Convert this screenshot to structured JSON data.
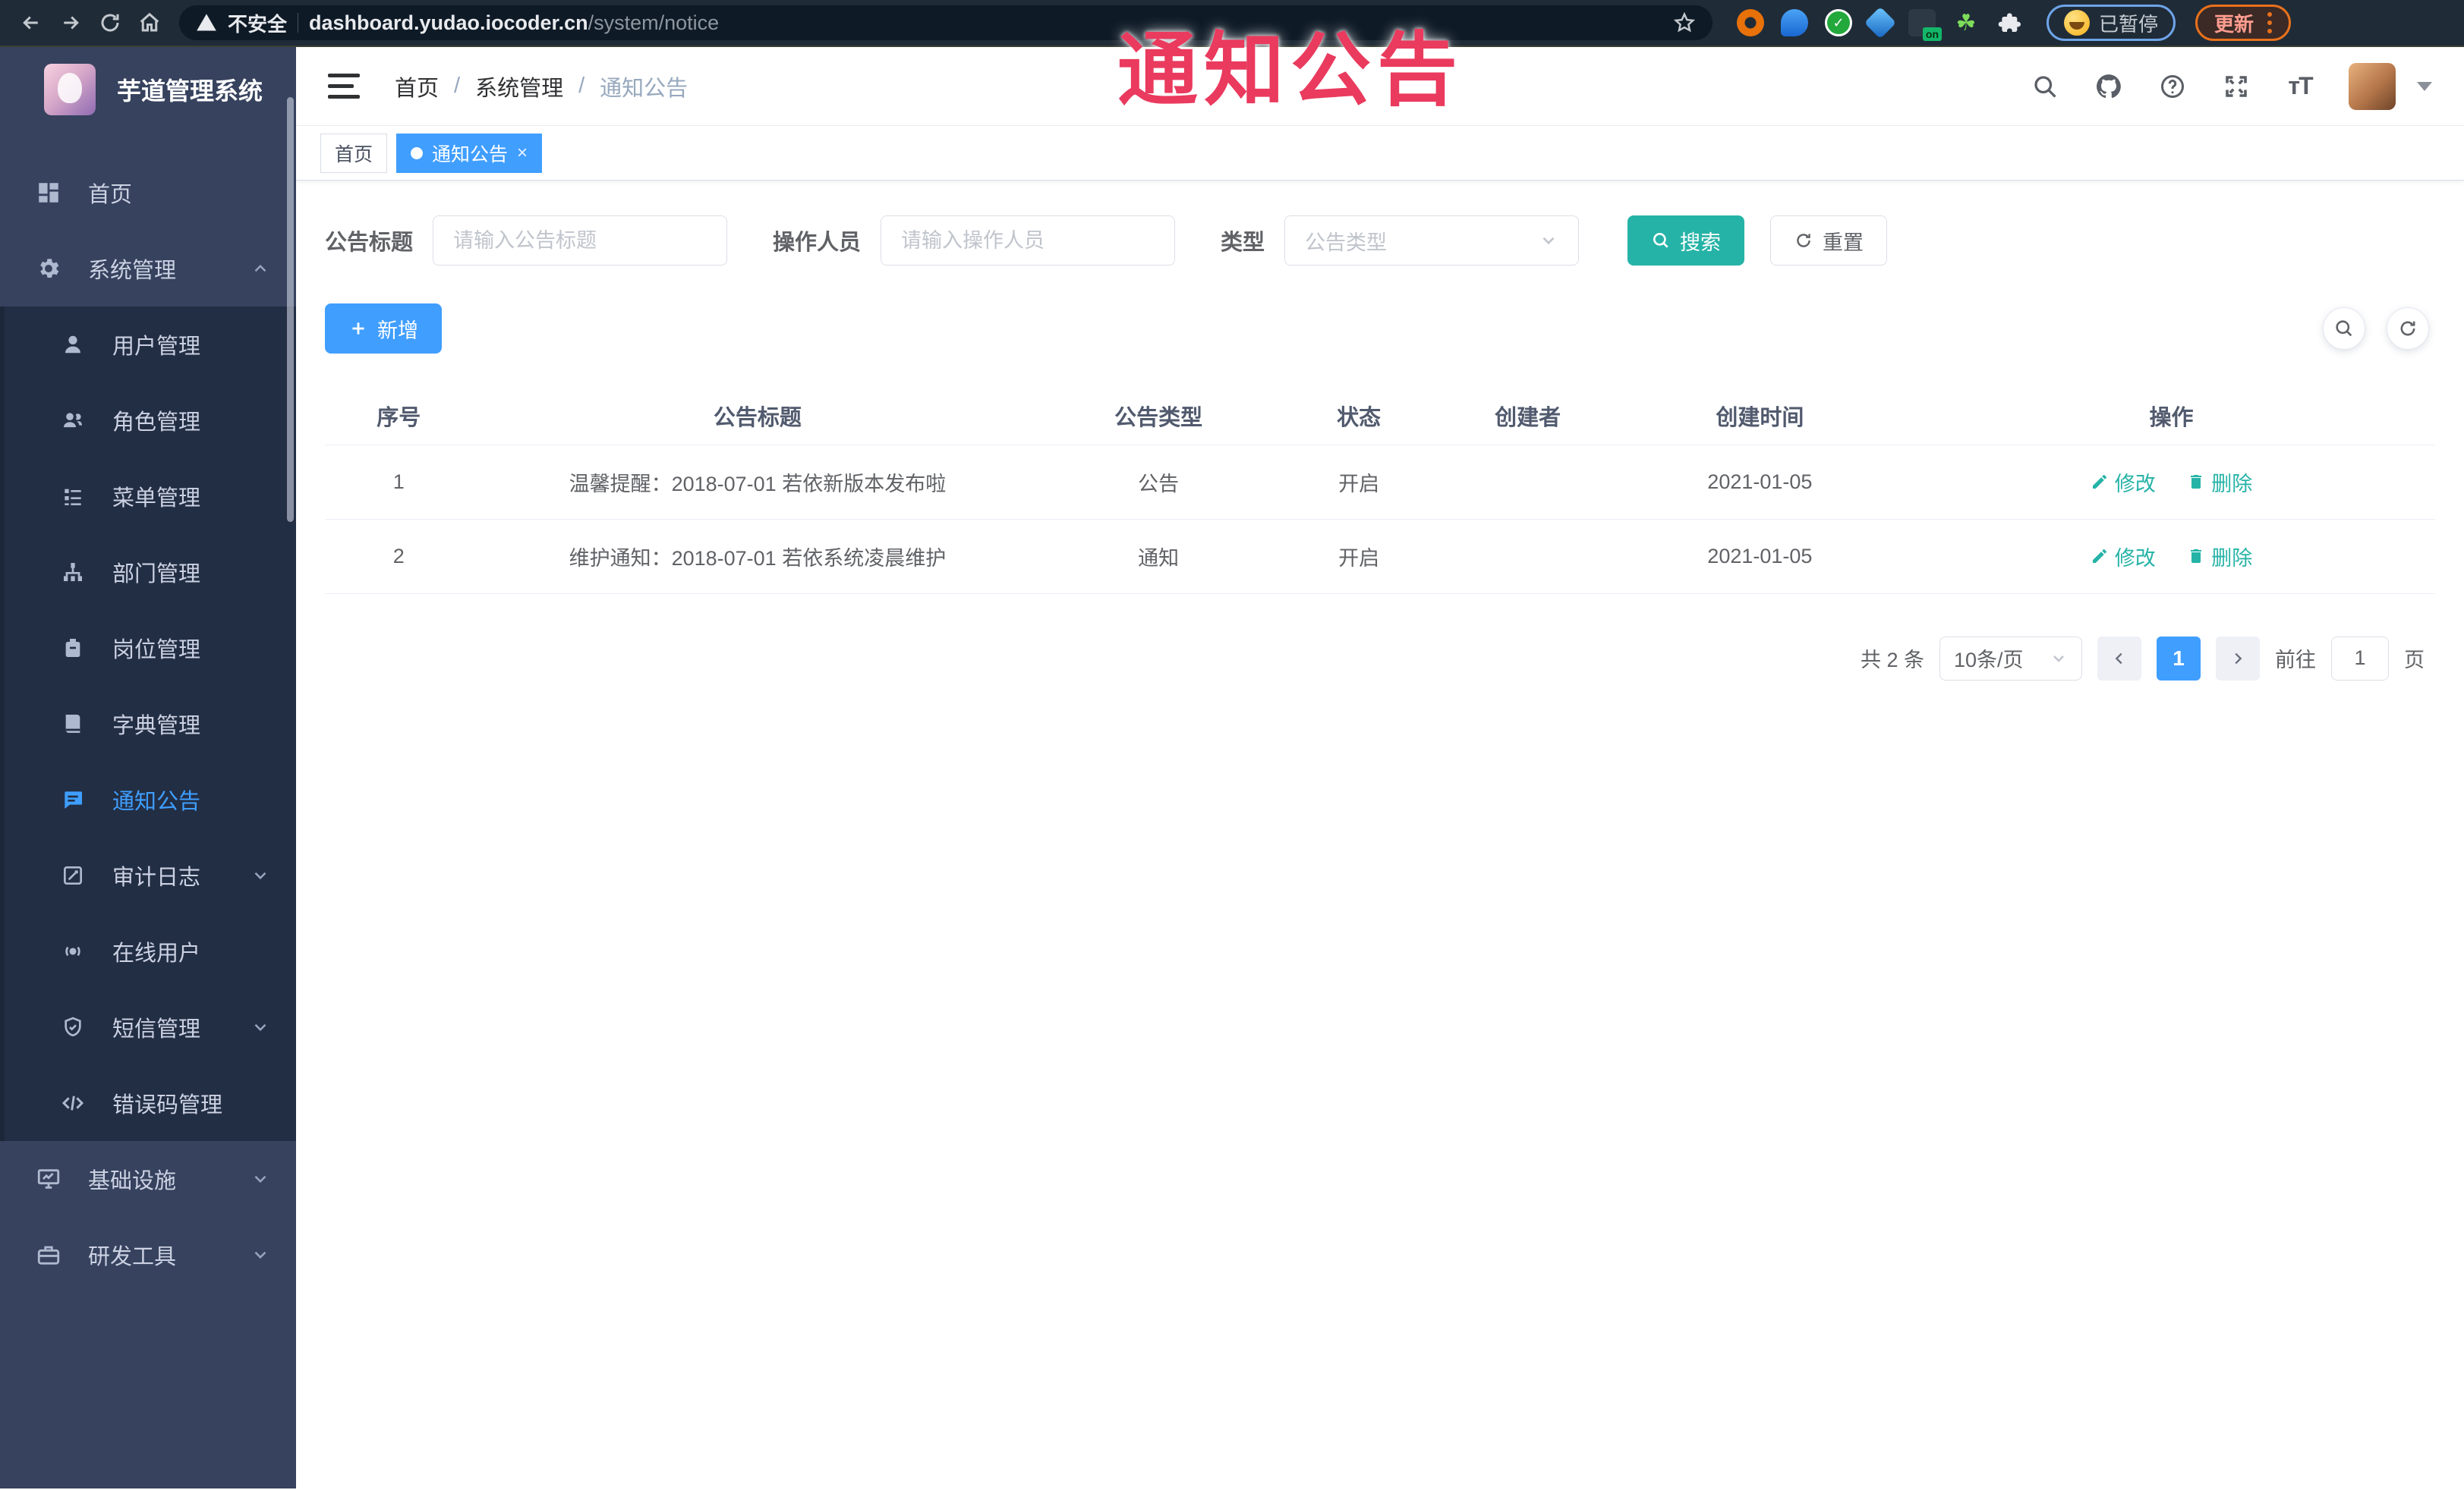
{
  "browser": {
    "security_warning": "不安全",
    "url_host": "dashboard.yudao.iocoder.cn",
    "url_path": "/system/notice",
    "paused_badge": "已暂停",
    "update_button": "更新",
    "extension_badge": "on"
  },
  "overlay": {
    "annotation": "通知公告"
  },
  "sidebar": {
    "app_title": "芋道管理系统",
    "items": [
      {
        "label": "首页",
        "icon": "dashboard-icon"
      },
      {
        "label": "系统管理",
        "icon": "gear-icon"
      },
      {
        "label": "用户管理",
        "icon": "user-icon"
      },
      {
        "label": "角色管理",
        "icon": "users-icon"
      },
      {
        "label": "菜单管理",
        "icon": "menu-list-icon"
      },
      {
        "label": "部门管理",
        "icon": "org-tree-icon"
      },
      {
        "label": "岗位管理",
        "icon": "badge-icon"
      },
      {
        "label": "字典管理",
        "icon": "dictionary-icon"
      },
      {
        "label": "通知公告",
        "icon": "announcement-icon"
      },
      {
        "label": "审计日志",
        "icon": "audit-log-icon"
      },
      {
        "label": "在线用户",
        "icon": "online-user-icon"
      },
      {
        "label": "短信管理",
        "icon": "sms-shield-icon"
      },
      {
        "label": "错误码管理",
        "icon": "error-code-icon"
      },
      {
        "label": "基础设施",
        "icon": "infrastructure-icon"
      },
      {
        "label": "研发工具",
        "icon": "dev-tools-icon"
      }
    ]
  },
  "header": {
    "breadcrumb": [
      "首页",
      "系统管理",
      "通知公告"
    ],
    "breadcrumb_separator": "/"
  },
  "tabs": {
    "home": "首页",
    "current": "通知公告",
    "close_glyph": "×"
  },
  "filters": {
    "title_label": "公告标题",
    "title_placeholder": "请输入公告标题",
    "operator_label": "操作人员",
    "operator_placeholder": "请输入操作人员",
    "type_label": "类型",
    "type_placeholder": "公告类型",
    "search_label": "搜索",
    "reset_label": "重置"
  },
  "toolbar": {
    "add_label": "新增"
  },
  "table": {
    "headers": [
      "序号",
      "公告标题",
      "公告类型",
      "状态",
      "创建者",
      "创建时间",
      "操作"
    ],
    "rows": [
      {
        "index": "1",
        "title": "温馨提醒：2018-07-01 若依新版本发布啦",
        "type": "公告",
        "status": "开启",
        "creator": "",
        "created": "2021-01-05"
      },
      {
        "index": "2",
        "title": "维护通知：2018-07-01 若依系统凌晨维护",
        "type": "通知",
        "status": "开启",
        "creator": "",
        "created": "2021-01-05"
      }
    ],
    "edit_label": "修改",
    "delete_label": "删除"
  },
  "pagination": {
    "total": "共 2 条",
    "page_size": "10条/页",
    "current_page": "1",
    "goto_label": "前往",
    "goto_value": "1",
    "page_unit": "页"
  },
  "colors": {
    "primary_blue": "#409eff",
    "teal_accent": "#26b3a7",
    "sidebar_bg": "#36425e",
    "submenu_bg": "#222e44",
    "annotation_red": "#ea3a5e",
    "chrome_bg": "#1f2b37"
  }
}
